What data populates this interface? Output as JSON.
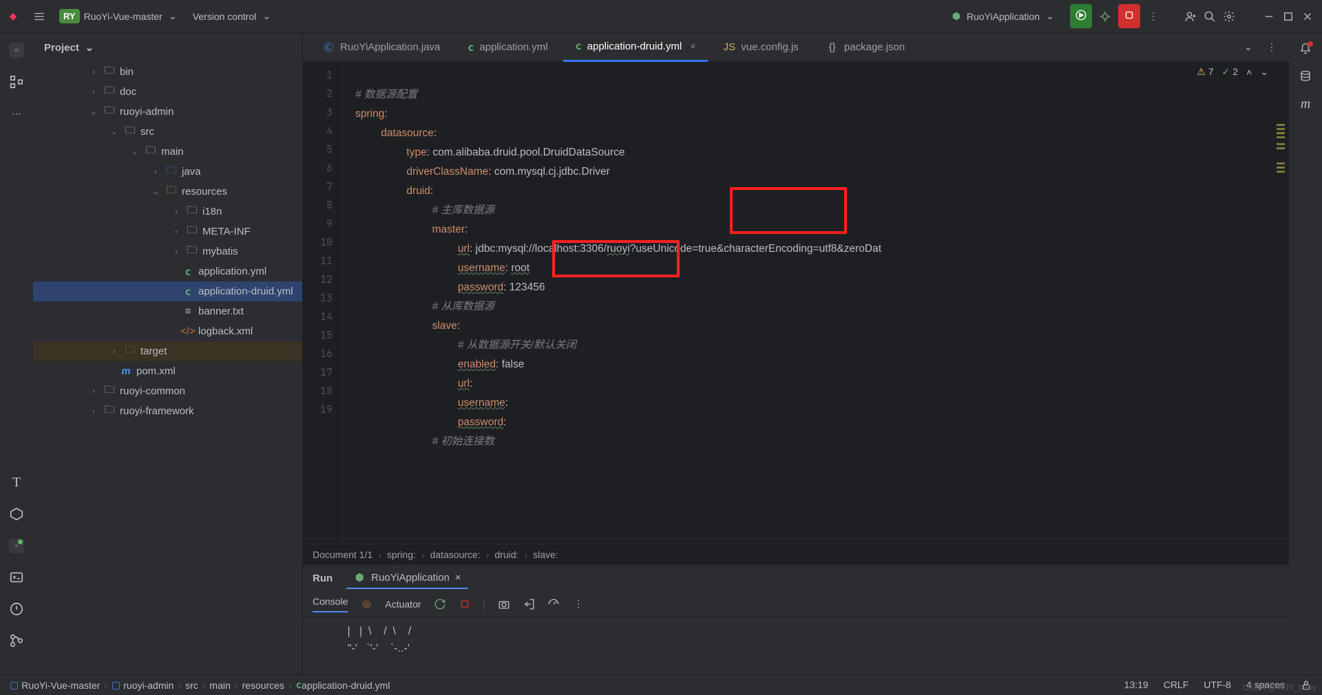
{
  "titlebar": {
    "project_badge": "RY",
    "project_name": "RuoYi-Vue-master",
    "vcs_label": "Version control",
    "run_config": "RuoYiApplication"
  },
  "project_tool": {
    "label": "Project"
  },
  "tree": {
    "bin": "bin",
    "doc": "doc",
    "ruoyi_admin": "ruoyi-admin",
    "src": "src",
    "main": "main",
    "java": "java",
    "resources": "resources",
    "i18n": "i18n",
    "meta_inf": "META-INF",
    "mybatis": "mybatis",
    "app_yml": "application.yml",
    "app_druid_yml": "application-druid.yml",
    "banner": "banner.txt",
    "logback": "logback.xml",
    "target": "target",
    "pom": "pom.xml",
    "ruoyi_common": "ruoyi-common",
    "ruoyi_framework": "ruoyi-framework"
  },
  "tabs": {
    "t0": "RuoYiApplication.java",
    "t1": "application.yml",
    "t2": "application-druid.yml",
    "t3": "vue.config.js",
    "t4": "package.json"
  },
  "inspection": {
    "warn": "7",
    "ok": "2"
  },
  "code": {
    "l1": "# 数据源配置",
    "l2a": "spring",
    "l2b": ":",
    "l3a": "datasource",
    "l3b": ":",
    "l4a": "type",
    "l4b": ": com.alibaba.druid.pool.DruidDataSource",
    "l5a": "driverClassName",
    "l5b": ": com.mysql.cj.jdbc.Driver",
    "l6a": "druid",
    "l6b": ":",
    "l7": "# 主库数据源",
    "l8a": "master",
    "l8b": ":",
    "l9a": "url",
    "l9b": ": jdbc:mysql://localhost:3306/",
    "l9c": "ruoyi",
    "l9d": "?useUnicode=true&characterEncoding=utf8&zeroDat",
    "l10a": "username",
    "l10b": ": ",
    "l10c": "root",
    "l11a": "password",
    "l11b": ": 123456",
    "l12": "# 从库数据源",
    "l13a": "slave",
    "l13b": ":",
    "l14": "# 从数据源开关/默认关闭",
    "l15a": "enabled",
    "l15b": ": false",
    "l16a": "url",
    "l16b": ":",
    "l17a": "username",
    "l17b": ":",
    "l18a": "password",
    "l18b": ":",
    "l19": "# 初始连接数"
  },
  "breadcrumb_editor": {
    "doc": "Document 1/1",
    "p1": "spring:",
    "p2": "datasource:",
    "p3": "druid:",
    "p4": "slave:"
  },
  "run": {
    "label": "Run",
    "tab": "RuoYiApplication",
    "console": "Console",
    "actuator": "Actuator",
    "output_l1": " |   |  \\    /  \\    /",
    "output_l2": " ''-'   `'-'    `-..-'"
  },
  "status": {
    "bc0": "RuoYi-Vue-master",
    "bc1": "ruoyi-admin",
    "bc2": "src",
    "bc3": "main",
    "bc4": "resources",
    "bc5": "application-druid.yml",
    "cursor": "13:19",
    "eol": "CRLF",
    "enc": "UTF-8",
    "indent": "4 spaces"
  },
  "watermark": "CSDN @WJY_baby"
}
